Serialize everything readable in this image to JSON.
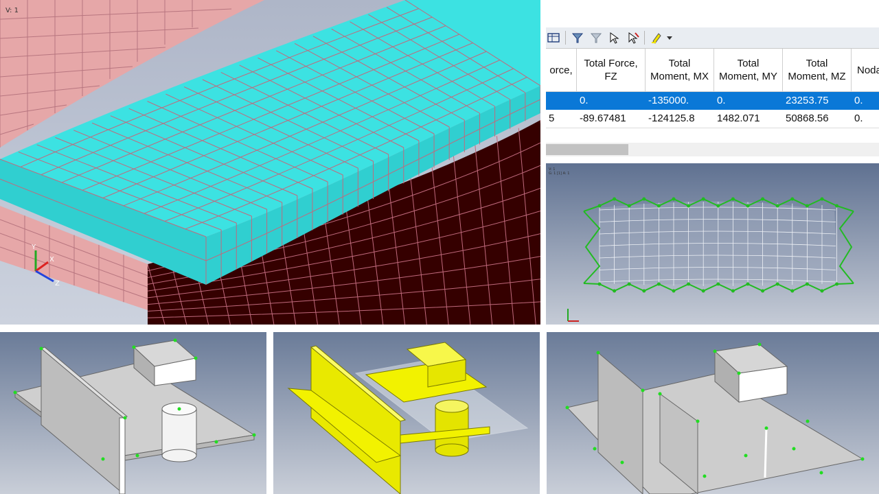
{
  "viewport_main": {
    "label": "V: 1"
  },
  "viewport_mesh": {
    "label": "V: 1",
    "sublabel": "G: 1 [1] A: 1"
  },
  "axes": {
    "x": "X",
    "y": "Y",
    "z": "Z"
  },
  "colors": {
    "cyan_face": "#36d6d6",
    "cyan_top": "#3fe4e4",
    "pink": "#e6a7a8",
    "dark_red": "#350000",
    "mesh_line": "#c06a7d",
    "green_mesh": "#22bb22",
    "yellow": "#f2f200",
    "gray_part": "#d0d0d0",
    "sel_row": "#0a78d7"
  },
  "toolbar": {
    "icons": [
      "columns-icon",
      "filter-icon",
      "filter-clear-icon",
      "pick-icon",
      "pick-clear-icon",
      "highlight-icon",
      "dropdown-icon"
    ]
  },
  "table": {
    "columns": [
      "orce,",
      "Total Force,\nFZ",
      "Total\nMoment, MX",
      "Total\nMoment, MY",
      "Total\nMoment, MZ",
      "Noda"
    ],
    "rows": [
      {
        "selected": true,
        "cells": [
          "",
          "0.",
          "-135000.",
          "0.",
          "23253.75",
          "0."
        ]
      },
      {
        "selected": false,
        "cells": [
          "5",
          "-89.67481",
          "-124125.8",
          "1482.071",
          "50868.56",
          "0."
        ]
      }
    ]
  }
}
